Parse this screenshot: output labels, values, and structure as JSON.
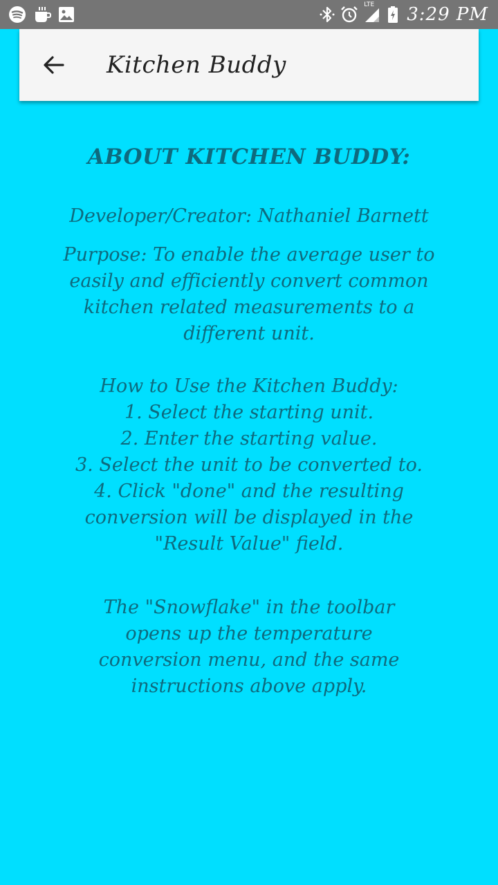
{
  "status_bar": {
    "time": "3:29 PM",
    "left_icons": [
      "spotify-icon",
      "coffee-icon",
      "image-icon"
    ],
    "right_icons": [
      "bluetooth-icon",
      "alarm-icon",
      "signal-lte-icon",
      "battery-charging-icon"
    ],
    "network_label": "LTE"
  },
  "toolbar": {
    "title": "Kitchen Buddy",
    "back_icon": "arrow-left-icon"
  },
  "about": {
    "heading": "ABOUT KITCHEN BUDDY:",
    "developer": "Developer/Creator: Nathaniel Barnett",
    "purpose": "Purpose: To enable the average user to easily and efficiently convert common kitchen related measurements to a different unit.",
    "how_to_title": "How to Use the Kitchen Buddy:",
    "steps": [
      "1. Select the starting unit.",
      "2. Enter the starting value.",
      "3. Select the unit to be converted to.",
      "4. Click \"done\" and the resulting conversion will be displayed in the \"Result Value\" field."
    ],
    "snowflake_note": "The \"Snowflake\" in the toolbar opens up the temperature conversion menu, and the same instructions above apply."
  },
  "colors": {
    "background": "#00DFFF",
    "status_bar": "#757575",
    "toolbar": "#F5F5F5",
    "text": "#0E6A7E"
  }
}
